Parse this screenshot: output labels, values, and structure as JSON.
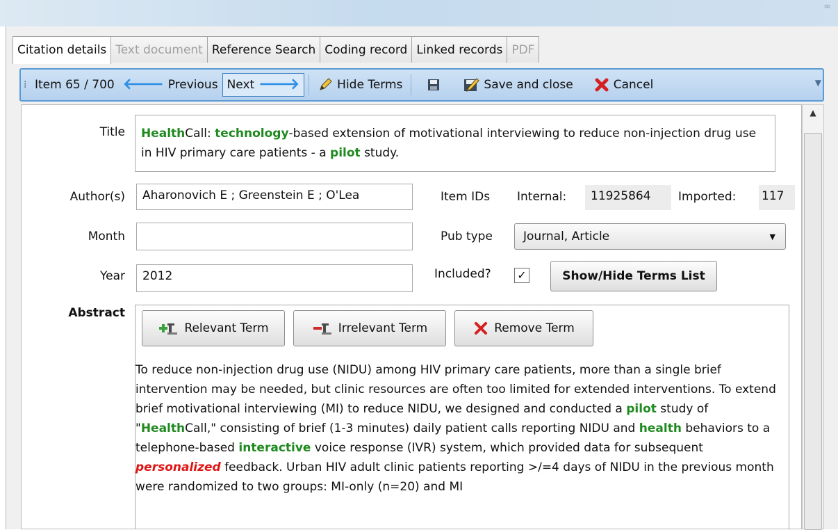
{
  "window": {
    "close_glyph": "∞"
  },
  "tabs": [
    {
      "label": "Citation details",
      "state": "active"
    },
    {
      "label": "Text document",
      "state": "disabled"
    },
    {
      "label": "Reference Search",
      "state": "normal"
    },
    {
      "label": "Coding record",
      "state": "normal"
    },
    {
      "label": "Linked records",
      "state": "normal"
    },
    {
      "label": "PDF",
      "state": "disabled"
    }
  ],
  "toolbar": {
    "item_counter": "Item 65 / 700",
    "previous_label": "Previous",
    "next_label": "Next",
    "hide_terms_label": "Hide Terms",
    "save_and_close_label": "Save and close",
    "cancel_label": "Cancel"
  },
  "form": {
    "title_label": "Title",
    "title_parts": {
      "p1": "Health",
      "p2": "Call: ",
      "p3": "technology",
      "p4": "-based extension of motivational interviewing to reduce non-injection drug use in HIV primary care patients - a ",
      "p5": "pilot",
      "p6": " study."
    },
    "authors_label": "Author(s)",
    "authors_value": "Aharonovich E ; Greenstein E ; O'Lea",
    "month_label": "Month",
    "month_value": "",
    "year_label": "Year",
    "year_value": "2012",
    "item_ids_label": "Item IDs",
    "internal_label": "Internal:",
    "internal_value": "11925864",
    "imported_label": "Imported:",
    "imported_value": "117",
    "pub_type_label": "Pub type",
    "pub_type_value": "Journal, Article",
    "included_label": "Included?",
    "included_checked": true,
    "check_glyph": "✓",
    "show_hide_terms_label": "Show/Hide Terms List"
  },
  "abstract": {
    "label": "Abstract",
    "relevant_term_label": "Relevant Term",
    "irrelevant_term_label": "Irrelevant Term",
    "remove_term_label": "Remove Term",
    "text_parts": {
      "a1": "To reduce non-injection drug use (NIDU) among HIV primary care patients, more than a single brief intervention may be needed, but clinic resources are often too limited for extended interventions. To extend brief motivational interviewing (MI) to reduce NIDU, we designed and conducted a ",
      "a2": "pilot",
      "a3": " study of \"",
      "a4": "Health",
      "a5": "Call,\" consisting of brief (1-3 minutes) daily patient calls reporting NIDU and ",
      "a6": "health",
      "a7": " behaviors to a telephone-based ",
      "a8": "interactive",
      "a9": " voice response (IVR) system, which provided data for subsequent ",
      "a10": "personalized",
      "a11": " feedback. Urban HIV adult clinic patients reporting >/=4 days of NIDU in the previous month were randomized to two groups: MI-only (n=20) and MI"
    }
  },
  "colors": {
    "relevant_highlight": "#1f8a1f",
    "irrelevant_highlight": "#e01414",
    "toolbar_border": "#5b9bd5",
    "arrow_blue": "#2f8ee6"
  },
  "icons": [
    "arrow-left-icon",
    "arrow-right-icon",
    "pencil-icon",
    "floppy-disk-icon",
    "save-close-icon",
    "cancel-x-icon",
    "add-term-icon",
    "irrelevant-term-icon",
    "remove-x-icon",
    "dropdown-caret-icon"
  ]
}
